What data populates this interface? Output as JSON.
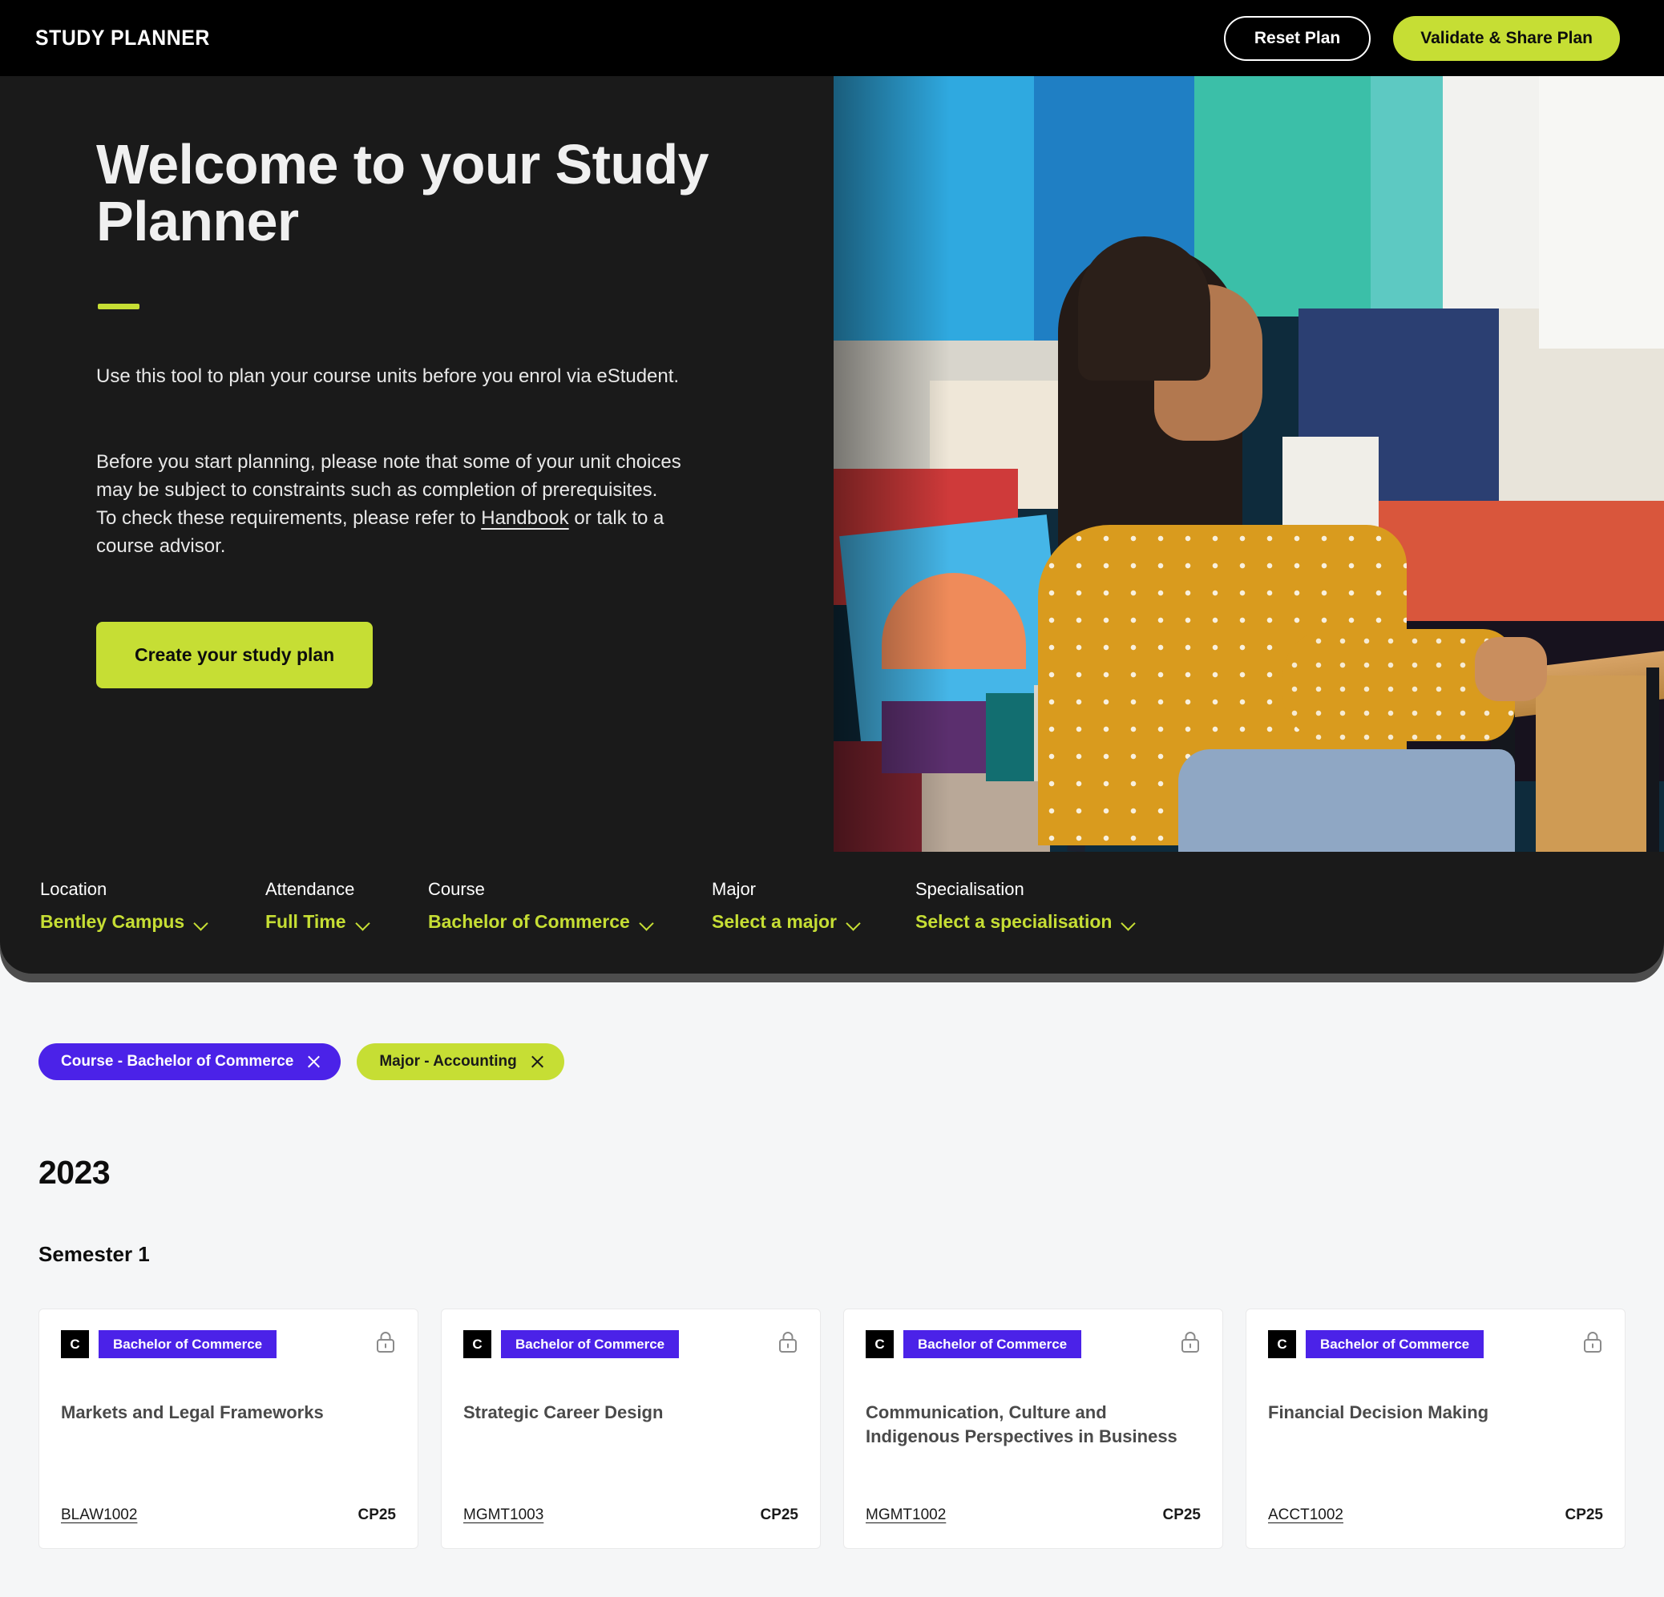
{
  "nav": {
    "brand": "STUDY PLANNER",
    "reset_label": "Reset Plan",
    "validate_label": "Validate & Share Plan"
  },
  "hero": {
    "title": "Welcome to your Study Planner",
    "paragraph_1": "Use this tool to plan your course units before you enrol via eStudent.",
    "paragraph_2_before": "Before you start planning, please note that some of your unit choices may be subject to constraints such as completion of prerequisites. To check these requirements, please refer to ",
    "handbook_link": "Handbook",
    "paragraph_2_after": " or talk to a course advisor.",
    "cta_label": "Create your study plan",
    "image_alt": "student-at-poster-wall-photo"
  },
  "filters": [
    {
      "label": "Location",
      "value": "Bentley Campus"
    },
    {
      "label": "Attendance",
      "value": "Full Time"
    },
    {
      "label": "Course",
      "value": "Bachelor of Commerce"
    },
    {
      "label": "Major",
      "value": "Select a major"
    },
    {
      "label": "Specialisation",
      "value": "Select a specialisation"
    }
  ],
  "chips": [
    {
      "label": "Course - Bachelor of Commerce",
      "color": "#4b22e8"
    },
    {
      "label": "Major - Accounting",
      "color": "#c6de34"
    }
  ],
  "plan": {
    "year": "2023",
    "semester": "Semester 1",
    "units": [
      {
        "type_badge": "C",
        "course_badge": "Bachelor of Commerce",
        "title": "Markets and Legal Frameworks",
        "code": "BLAW1002",
        "credit": "CP25",
        "locked": true
      },
      {
        "type_badge": "C",
        "course_badge": "Bachelor of Commerce",
        "title": "Strategic Career Design",
        "code": "MGMT1003",
        "credit": "CP25",
        "locked": true
      },
      {
        "type_badge": "C",
        "course_badge": "Bachelor of Commerce",
        "title": "Communication, Culture and Indigenous Perspectives in Business",
        "code": "MGMT1002",
        "credit": "CP25",
        "locked": true
      },
      {
        "type_badge": "C",
        "course_badge": "Bachelor of Commerce",
        "title": "Financial Decision Making",
        "code": "ACCT1002",
        "credit": "CP25",
        "locked": true
      }
    ]
  },
  "colors": {
    "accent_lime": "#c6de34",
    "accent_purple": "#4b22e8",
    "dark": "#1a1a1a",
    "black": "#000000",
    "page_bg": "#f5f6f7"
  }
}
